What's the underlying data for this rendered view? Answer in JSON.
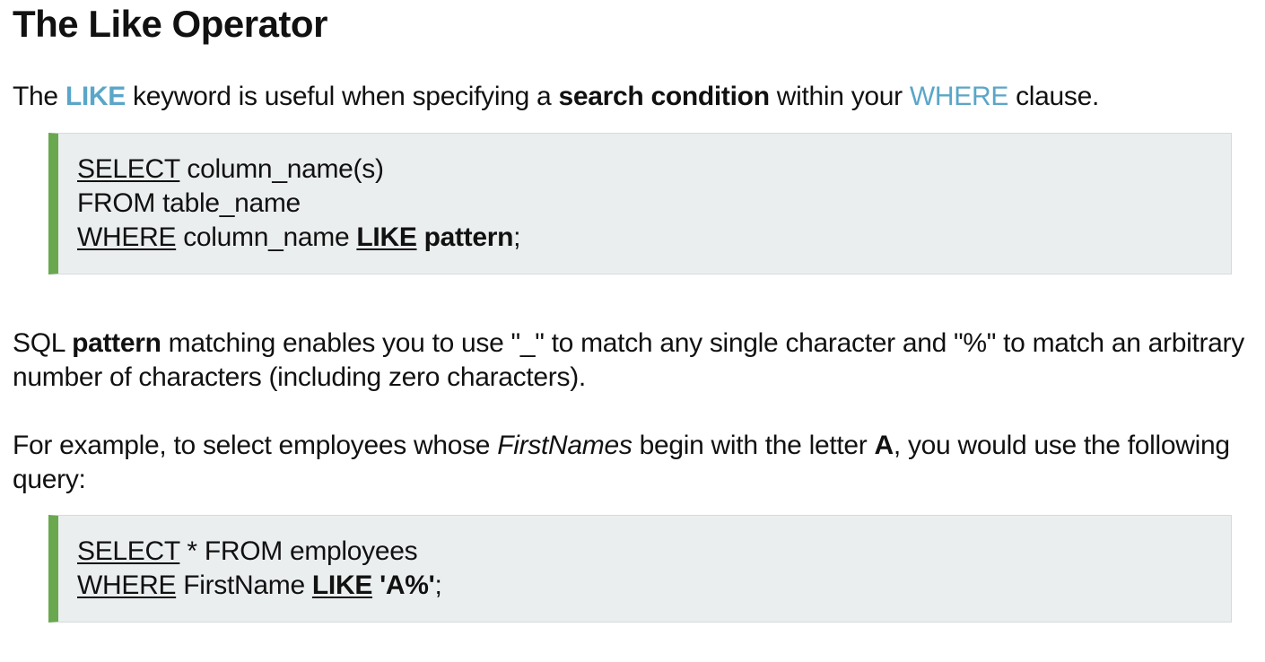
{
  "title": "The Like Operator",
  "intro": {
    "t1": "The ",
    "like": "LIKE",
    "t2": " keyword is useful when specifying a ",
    "search_condition": "search condition",
    "t3": " within your ",
    "where": "WHERE",
    "t4": " clause."
  },
  "code1": {
    "l1_kw": "SELECT",
    "l1_rest": " column_name(s)",
    "l2": "FROM table_name",
    "l3_kw": "WHERE",
    "l3_mid": " column_name ",
    "l3_like": "LIKE",
    "l3_sp": " ",
    "l3_pattern": "pattern",
    "l3_end": ";"
  },
  "pattern_para": {
    "t1": "SQL ",
    "pattern": "pattern",
    "t2": " matching enables you to use \"_\" to match any single character and \"%\" to match an arbitrary number of characters (including zero characters)."
  },
  "example_para": {
    "t1": "For example, to select employees whose ",
    "firstnames": "FirstNames",
    "t2": " begin with the letter ",
    "letter": "A",
    "t3": ", you would use the following query:"
  },
  "code2": {
    "l1_kw": "SELECT",
    "l1_rest": " * FROM employees",
    "l2_kw": "WHERE",
    "l2_mid": " FirstName ",
    "l2_like": "LIKE",
    "l2_sp": " ",
    "l2_val": "'A%'",
    "l2_end": ";"
  },
  "colors": {
    "keyword_blue": "#5aa6c8",
    "code_bg": "#ebeeef",
    "code_accent": "#6aa84f"
  }
}
